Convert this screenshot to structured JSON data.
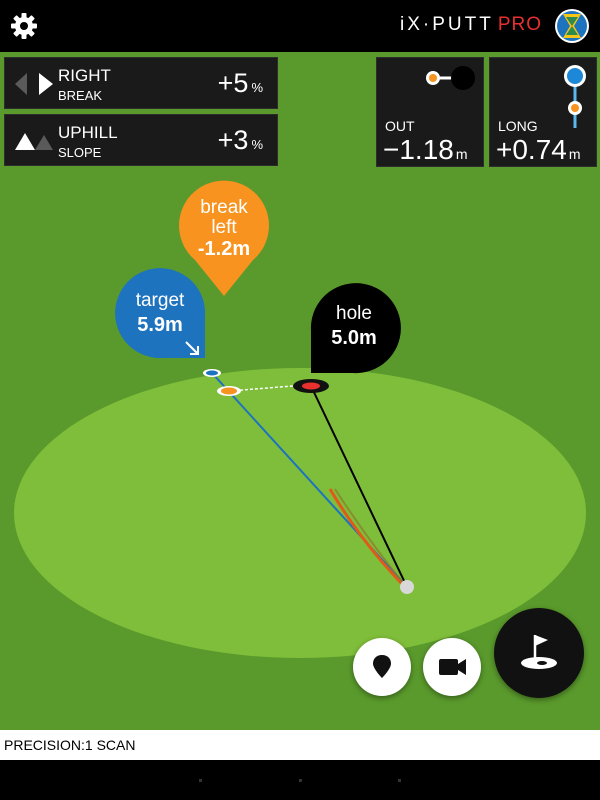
{
  "app": {
    "brand": "iX·PUTT",
    "brand_suffix": "PRO",
    "settings_icon": "gear-icon",
    "logo_icon": "ix-logo-icon"
  },
  "break_panel": {
    "direction": "RIGHT",
    "caption": "BREAK",
    "value": "+5",
    "unit": "%",
    "icon": "break-direction-icon"
  },
  "slope_panel": {
    "direction": "UPHILL",
    "caption": "SLOPE",
    "value": "+3",
    "unit": "%",
    "icon": "slope-icon"
  },
  "out_panel": {
    "label": "OUT",
    "value": "−1.18",
    "unit": "m",
    "icon": "lateral-offset-icon"
  },
  "long_panel": {
    "label": "LONG",
    "value": "+0.74",
    "unit": "m",
    "icon": "longitudinal-offset-icon"
  },
  "callouts": {
    "break": {
      "line1": "break",
      "line2": "left",
      "value": "-1.2m",
      "color": "#f7931e"
    },
    "target": {
      "label": "target",
      "value": "5.9m",
      "color": "#1e73be",
      "icon": "arrow-down-right-icon"
    },
    "hole": {
      "label": "hole",
      "value": "5.0m",
      "color": "#000000"
    }
  },
  "green_colors": {
    "fairway": "#5a9a2c",
    "green": "#7fbe3a"
  },
  "buttons": {
    "pin": {
      "icon": "map-pin-icon"
    },
    "camera": {
      "icon": "video-camera-icon"
    },
    "flag": {
      "icon": "golf-flag-icon"
    }
  },
  "status": {
    "precision_label": "PRECISION:",
    "precision_value": "1 SCAN"
  }
}
